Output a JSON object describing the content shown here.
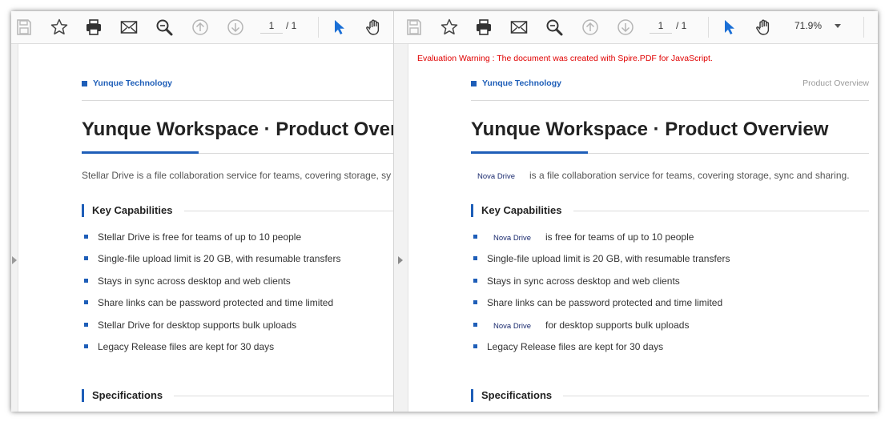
{
  "left_pane": {
    "toolbar": {
      "page_current": "1",
      "page_total": "/ 1"
    },
    "document": {
      "brand": "Yunque Technology",
      "title": "Yunque Workspace · Product Overview",
      "intro": "Stellar Drive is a file collaboration service for teams, covering storage, sy",
      "section_capabilities": "Key Capabilities",
      "items": [
        "Stellar Drive is free for teams of up to 10 people",
        "Single-file upload limit is 20 GB, with resumable transfers",
        "Stays in sync across desktop and web clients",
        "Share links can be password protected and time limited",
        "Stellar Drive for desktop supports bulk uploads",
        "Legacy Release files are kept for 30 days"
      ],
      "section_specs": "Specifications"
    }
  },
  "right_pane": {
    "toolbar": {
      "page_current": "1",
      "page_total": "/ 1",
      "zoom": "71.9%"
    },
    "document": {
      "warning": "Evaluation Warning : The document was created with Spire.PDF for JavaScript.",
      "brand": "Yunque Technology",
      "header_right": "Product Overview",
      "title": "Yunque Workspace · Product Overview",
      "intro_chip": "Nova Drive",
      "intro_rest": "is a file collaboration service for teams, covering storage, sync and sharing.",
      "section_capabilities": "Key Capabilities",
      "items": [
        {
          "chip": "Nova Drive",
          "text": "is free for teams of up to 10 people"
        },
        {
          "chip": "",
          "text": "Single-file upload limit is 20 GB, with resumable transfers"
        },
        {
          "chip": "",
          "text": "Stays in sync across desktop and web clients"
        },
        {
          "chip": "",
          "text": "Share links can be password protected and time limited"
        },
        {
          "chip": "Nova Drive",
          "text": "for desktop supports bulk uploads"
        },
        {
          "chip": "",
          "text": "Legacy Release files are kept for 30 days"
        }
      ],
      "section_specs": "Specifications"
    }
  },
  "colors": {
    "accent": "#1e5eb8",
    "warning": "#e00000",
    "cursor_active": "#1a6fd6"
  },
  "icons": [
    "save-icon",
    "bookmark-star-icon",
    "print-icon",
    "email-icon",
    "search-icon",
    "page-up-icon",
    "page-down-icon",
    "select-cursor-icon",
    "hand-pan-icon",
    "zoom-dropdown-icon"
  ]
}
